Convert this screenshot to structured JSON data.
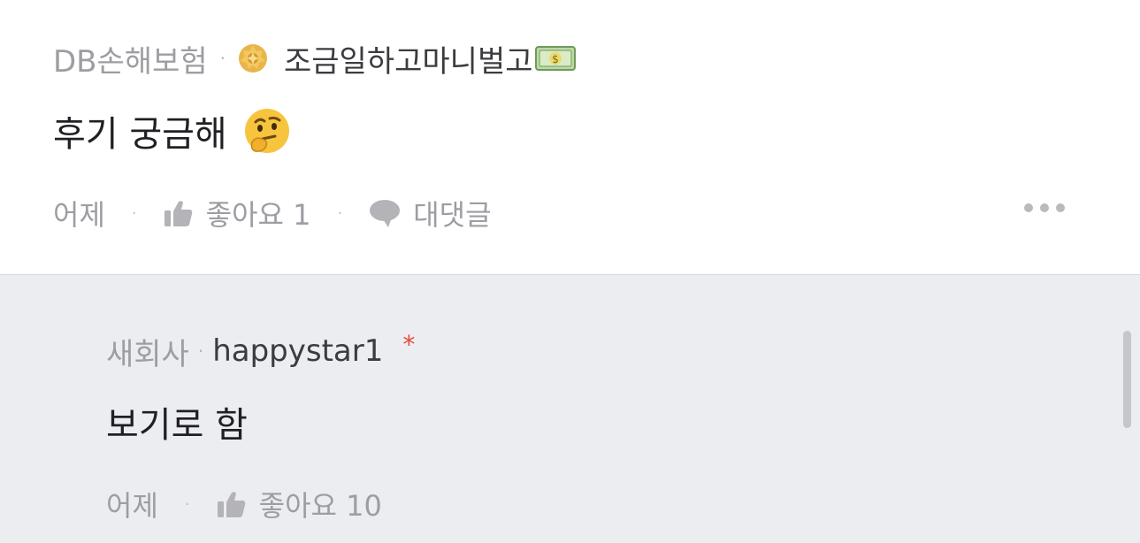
{
  "comment": {
    "company": "DB손해보험",
    "separator": "·",
    "nickname": "조금일하고마니벌고",
    "badge_icon": "gold-medal-icon",
    "nickname_emoji": "money-bill-emoji-icon",
    "body": "후기 궁금해",
    "body_emoji": "thinking-face-emoji-icon",
    "time": "어제",
    "like_label": "좋아요 1",
    "reply_label": "대댓글",
    "more_icon": "more-options-icon"
  },
  "reply": {
    "company": "새회사",
    "separator": "·",
    "nickname": "happystar1",
    "author_marker": "*",
    "body": "보기로 함",
    "time": "어제",
    "like_label": "좋아요 10"
  },
  "colors": {
    "background": "#ffffff",
    "reply_background": "#ecedf1",
    "muted_text": "#9d9da3",
    "body_text": "#1f1f24",
    "author_marker": "#e2493c"
  }
}
